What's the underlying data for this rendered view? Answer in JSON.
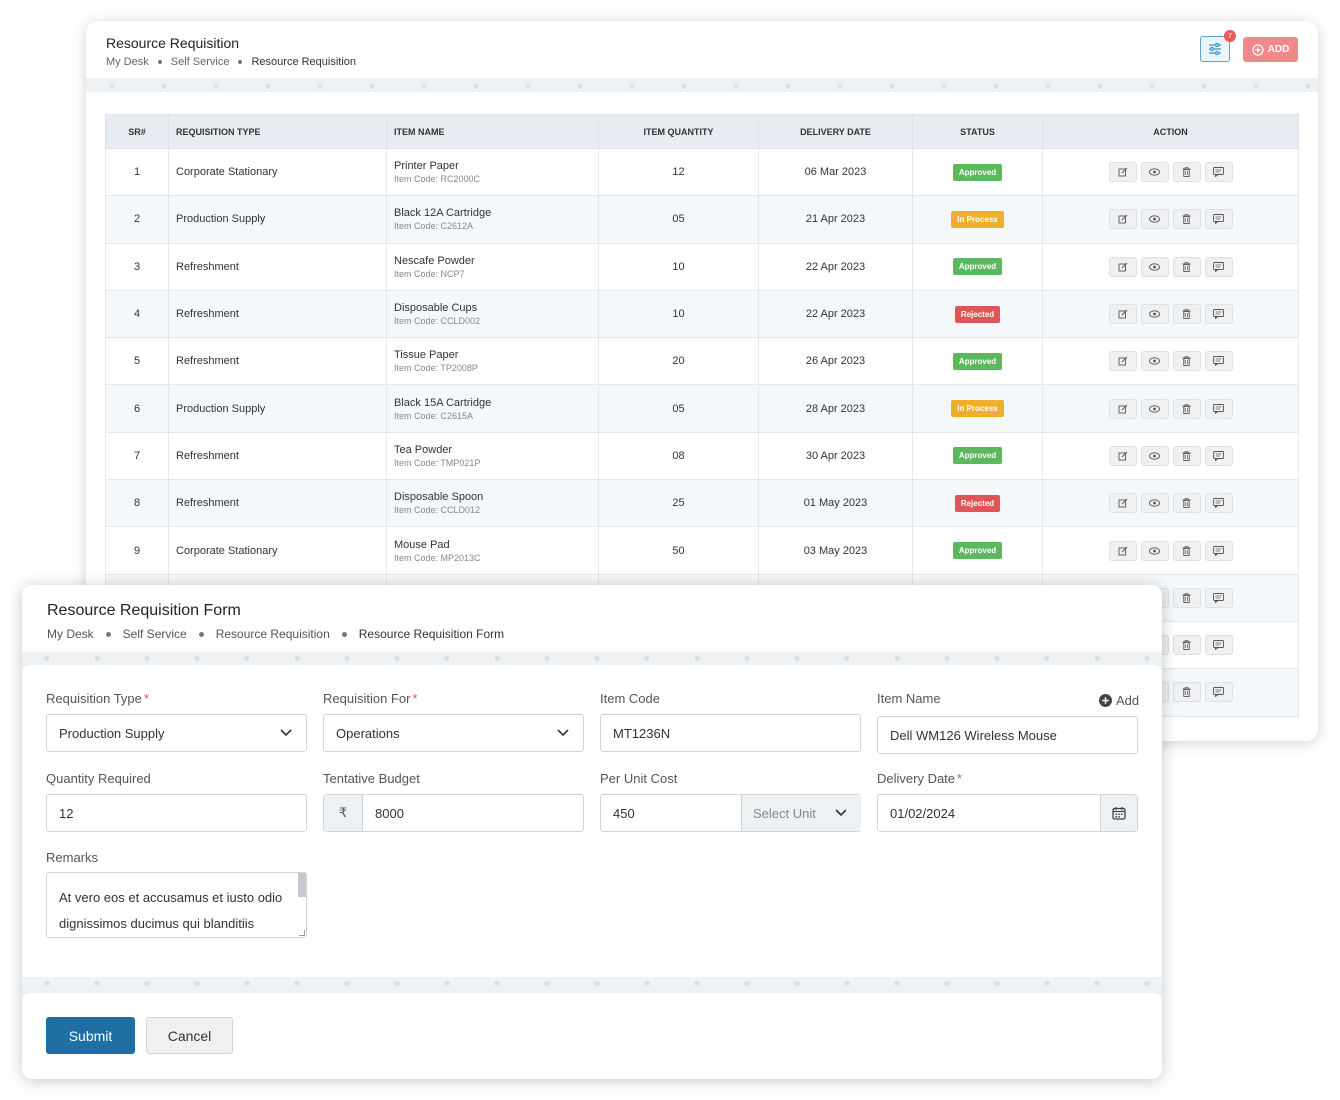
{
  "list": {
    "title": "Resource Requisition",
    "breadcrumb": [
      "My Desk",
      "Self Service",
      "Resource Requisition"
    ],
    "filter_count": "7",
    "add_label": "ADD",
    "columns": [
      "SR#",
      "REQUISITION TYPE",
      "ITEM NAME",
      "ITEM QUANTITY",
      "DELIVERY DATE",
      "STATUS",
      "ACTION"
    ],
    "rows": [
      {
        "sr": "1",
        "type": "Corporate Stationary",
        "item": "Printer Paper",
        "code": "Item Code: RC2000C",
        "qty": "12",
        "date": "06 Mar 2023",
        "status": "Approved"
      },
      {
        "sr": "2",
        "type": "Production Supply",
        "item": "Black 12A Cartridge",
        "code": "Item Code: C2612A",
        "qty": "05",
        "date": "21 Apr 2023",
        "status": "In Process"
      },
      {
        "sr": "3",
        "type": "Refreshment",
        "item": "Nescafe Powder",
        "code": "Item Code: NCP7",
        "qty": "10",
        "date": "22 Apr 2023",
        "status": "Approved"
      },
      {
        "sr": "4",
        "type": "Refreshment",
        "item": "Disposable Cups",
        "code": "Item Code: CCLD002",
        "qty": "10",
        "date": "22 Apr 2023",
        "status": "Rejected"
      },
      {
        "sr": "5",
        "type": "Refreshment",
        "item": "Tissue Paper",
        "code": "Item Code: TP2008P",
        "qty": "20",
        "date": "26 Apr 2023",
        "status": "Approved"
      },
      {
        "sr": "6",
        "type": "Production Supply",
        "item": "Black 15A Cartridge",
        "code": "Item Code: C2615A",
        "qty": "05",
        "date": "28 Apr 2023",
        "status": "In Process"
      },
      {
        "sr": "7",
        "type": "Refreshment",
        "item": "Tea Powder",
        "code": "Item Code: TMP021P",
        "qty": "08",
        "date": "30 Apr 2023",
        "status": "Approved"
      },
      {
        "sr": "8",
        "type": "Refreshment",
        "item": "Disposable Spoon",
        "code": "Item Code: CCLD012",
        "qty": "25",
        "date": "01 May 2023",
        "status": "Rejected"
      },
      {
        "sr": "9",
        "type": "Corporate Stationary",
        "item": "Mouse Pad",
        "code": "Item Code: MP2013C",
        "qty": "50",
        "date": "03 May 2023",
        "status": "Approved"
      },
      {
        "sr": "",
        "type": "",
        "item": "",
        "code": "",
        "qty": "",
        "date": "",
        "status": ""
      },
      {
        "sr": "",
        "type": "",
        "item": "",
        "code": "",
        "qty": "",
        "date": "",
        "status": ""
      },
      {
        "sr": "",
        "type": "",
        "item": "",
        "code": "",
        "qty": "",
        "date": "",
        "status": ""
      }
    ],
    "status_colors": {
      "Approved": "#5cb85c",
      "In Process": "#f0ad2e",
      "Rejected": "#e05555"
    },
    "action_icons": [
      "edit-icon",
      "view-icon",
      "delete-icon",
      "comment-icon"
    ]
  },
  "form": {
    "title": "Resource Requisition Form",
    "breadcrumb": [
      "My Desk",
      "Self Service",
      "Resource Requisition",
      "Resource Requisition Form"
    ],
    "fields": {
      "requisition_type": {
        "label": "Requisition Type",
        "value": "Production Supply"
      },
      "requisition_for": {
        "label": "Requisition For",
        "value": "Operations"
      },
      "item_code": {
        "label": "Item Code",
        "value": "MT1236N"
      },
      "item_name": {
        "label": "Item Name",
        "value": "Dell WM126 Wireless Mouse",
        "add_label": "Add"
      },
      "quantity": {
        "label": "Quantity Required",
        "value": "12"
      },
      "budget": {
        "label": "Tentative Budget",
        "prefix": "₹",
        "value": "8000"
      },
      "unit_cost": {
        "label": "Per Unit Cost",
        "value": "450",
        "unit_placeholder": "Select Unit"
      },
      "delivery_date": {
        "label": "Delivery Date",
        "value": "01/02/2024"
      },
      "remarks": {
        "label": "Remarks",
        "value": "At vero eos et accusamus et iusto odio dignissimos ducimus qui blanditiis"
      }
    },
    "submit_label": "Submit",
    "cancel_label": "Cancel"
  },
  "colors": {
    "primary": "#1f6fa3",
    "accent_add": "#f08a8a",
    "required": "#e05555"
  }
}
